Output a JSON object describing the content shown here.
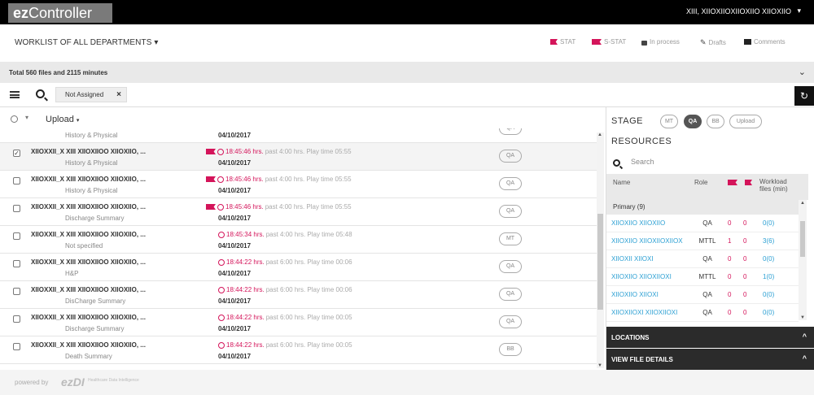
{
  "app": {
    "logo_prefix": "ez",
    "logo_name": "Controller",
    "user_name": "XIII, XIIOXIIOXIIOXIIO XIIOXIIO"
  },
  "worklist": {
    "title": "WORKLIST OF ALL DEPARTMENTS"
  },
  "legend": {
    "stat": "STAT",
    "sstat": "S-STAT",
    "inprocess": "In process",
    "drafts": "Drafts",
    "comments": "Comments"
  },
  "totals": {
    "text": "Total 560 files and 2115 minutes"
  },
  "filter": {
    "chip_label": "Not Assigned"
  },
  "list": {
    "upload_label": "Upload"
  },
  "rows": [
    {
      "name": "",
      "type": "History & Physical",
      "time": "",
      "info": "",
      "date": "04/10/2017",
      "stage": "QA"
    },
    {
      "name": "XIIOXXII_X XIII XIIOXIIOO XIIOXIIO, ...",
      "type": "History & Physical",
      "time": "18:45:46 hrs.",
      "info": "past 4:00 hrs. Play time 05:55",
      "date": "04/10/2017",
      "stage": "QA"
    },
    {
      "name": "XIIOXXII_X XIII XIIOXIIOO XIIOXIIO, ...",
      "type": "History & Physical",
      "time": "18:45:46 hrs.",
      "info": "past 4:00 hrs. Play time 05:55",
      "date": "04/10/2017",
      "stage": "QA"
    },
    {
      "name": "XIIOXXII_X XIII XIIOXIIOO XIIOXIIO, ...",
      "type": "Discharge Summary",
      "time": "18:45:46 hrs.",
      "info": "past 4:00 hrs. Play time 05:55",
      "date": "04/10/2017",
      "stage": "QA"
    },
    {
      "name": "XIIOXXII_X XIII XIIOXIIOO XIIOXIIO, ...",
      "type": "Not specified",
      "time": "18:45:34 hrs.",
      "info": "past 4:00 hrs. Play time 05:48",
      "date": "04/10/2017",
      "stage": "MT"
    },
    {
      "name": "XIIOXXII_X XIII XIIOXIIOO XIIOXIIO, ...",
      "type": "H&P",
      "time": "18:44:22 hrs.",
      "info": "past 6:00 hrs. Play time 00:06",
      "date": "04/10/2017",
      "stage": "QA"
    },
    {
      "name": "XIIOXXII_X XIII XIIOXIIOO XIIOXIIO, ...",
      "type": "DisCharge Summary",
      "time": "18:44:22 hrs.",
      "info": "past 6:00 hrs. Play time 00:06",
      "date": "04/10/2017",
      "stage": "QA"
    },
    {
      "name": "XIIOXXII_X XIII XIIOXIIOO XIIOXIIO, ...",
      "type": "Discharge Summary",
      "time": "18:44:22 hrs.",
      "info": "past 6:00 hrs. Play time 00:05",
      "date": "04/10/2017",
      "stage": "QA"
    },
    {
      "name": "XIIOXXII_X XIII XIIOXIIOO XIIOXIIO, ...",
      "type": "Death Summary",
      "time": "18:44:22 hrs.",
      "info": "past 6:00 hrs. Play time 00:05",
      "date": "04/10/2017",
      "stage": "BB"
    }
  ],
  "panel": {
    "stage_label": "STAGE",
    "stage_options": [
      "MT",
      "QA",
      "BB",
      "Upload"
    ],
    "resources_label": "RESOURCES",
    "search_placeholder": "Search",
    "col_name": "Name",
    "col_role": "Role",
    "col_workload": "Workload files (min)",
    "group": "Primary (9)",
    "resources": [
      {
        "name": "XIIOXIIO XIIOXIIO",
        "role": "QA",
        "a": "0",
        "b": "0",
        "w": "0(0)"
      },
      {
        "name": "XIIOXIIO XIIOXIIOXIIOX",
        "role": "MTTL",
        "a": "1",
        "b": "0",
        "w": "3(6)"
      },
      {
        "name": "XIIOXII XIIOXI",
        "role": "QA",
        "a": "0",
        "b": "0",
        "w": "0(0)"
      },
      {
        "name": "XIIOXIIO XIIOXIIOXI",
        "role": "MTTL",
        "a": "0",
        "b": "0",
        "w": "1(0)"
      },
      {
        "name": "XIIOXIIO XIIOXI",
        "role": "QA",
        "a": "0",
        "b": "0",
        "w": "0(0)"
      },
      {
        "name": "XIIOXIIOXI XIIOXIIOXI",
        "role": "QA",
        "a": "0",
        "b": "0",
        "w": "0(0)"
      }
    ],
    "locations_label": "LOCATIONS",
    "view_details_label": "VIEW FILE DETAILS"
  },
  "footer": {
    "powered_by": "powered by",
    "logo": "ezDI",
    "sub": "Healthcare Data Intelligence"
  },
  "colors": {
    "accent": "#d4145a",
    "link": "#2b9fd3",
    "dark": "#2b2b2b"
  }
}
